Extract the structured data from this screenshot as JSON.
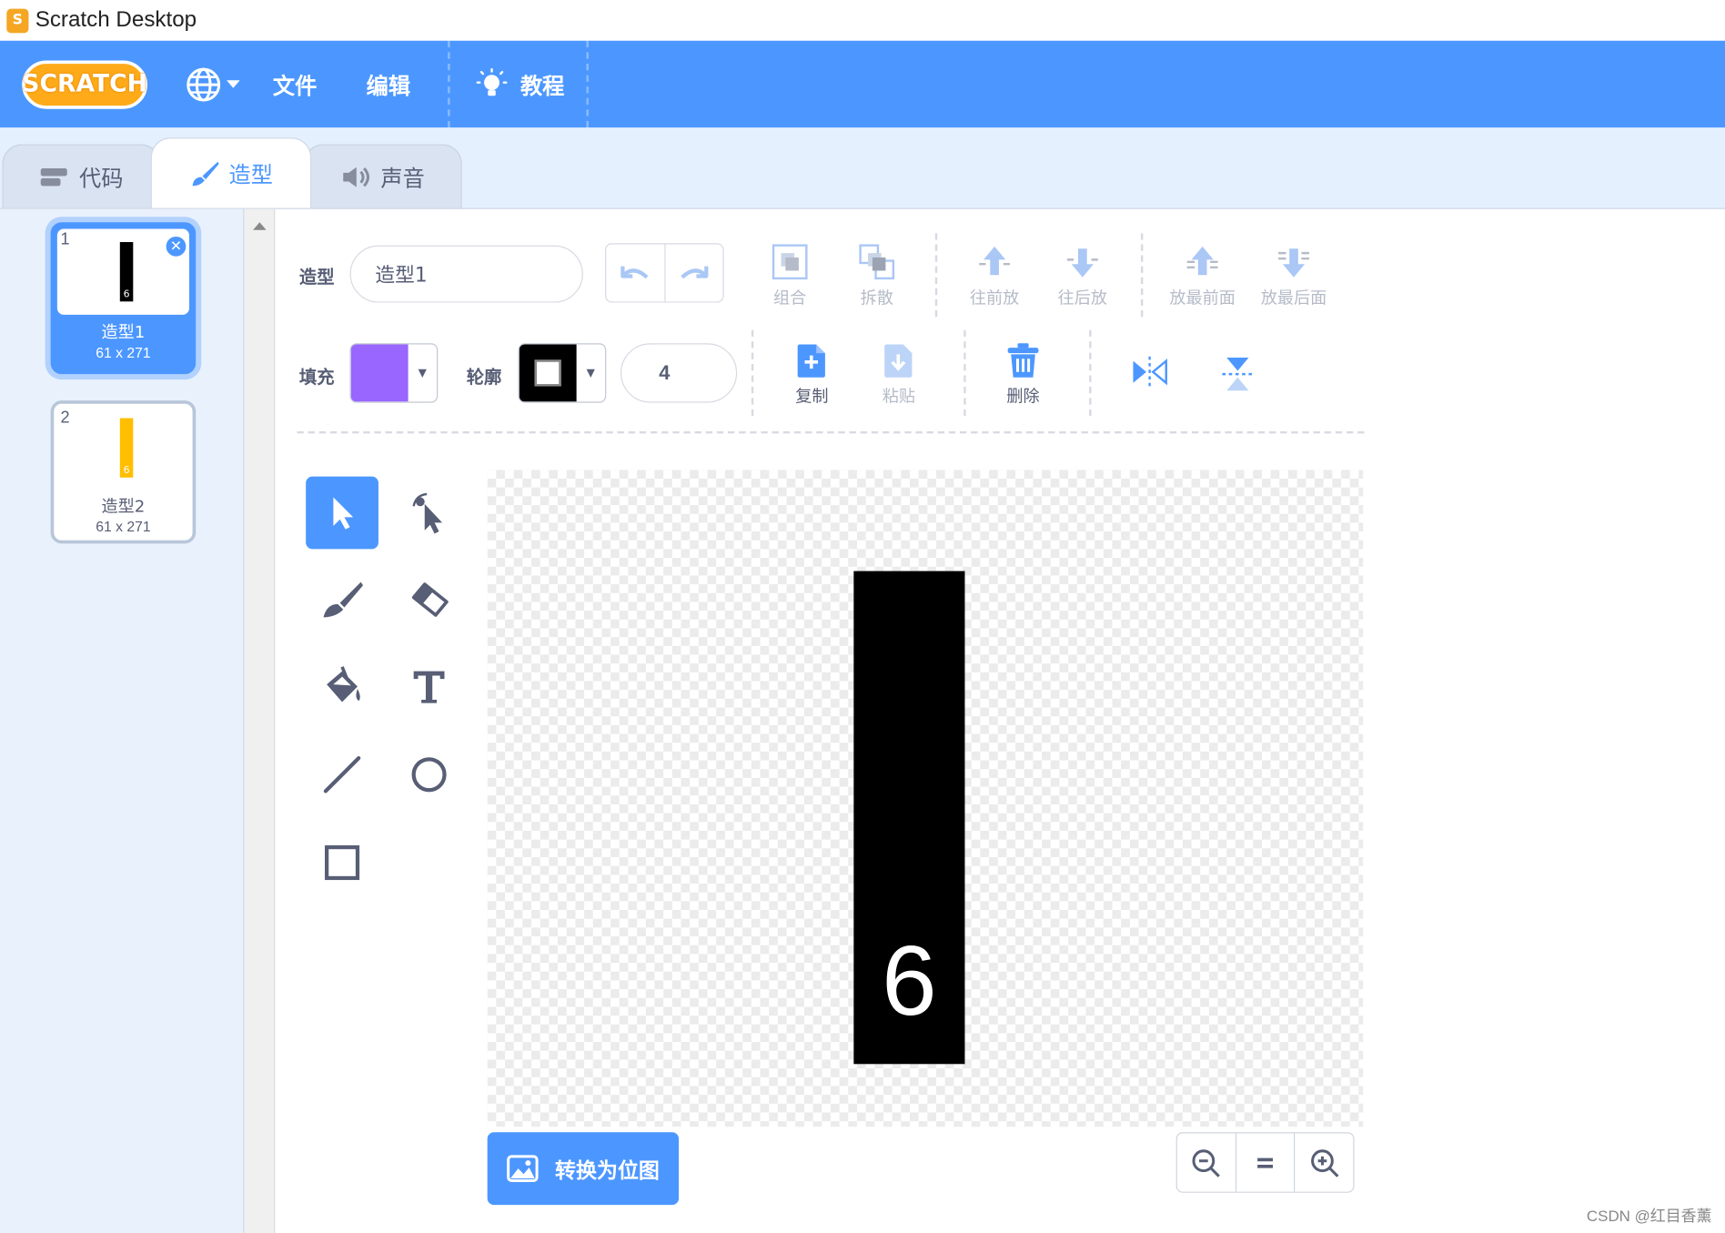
{
  "window": {
    "title": "Scratch Desktop"
  },
  "menubar": {
    "logo": "SCRATCH",
    "file": "文件",
    "edit": "编辑",
    "tutorials": "教程"
  },
  "tabs": [
    {
      "label": "代码",
      "active": false
    },
    {
      "label": "造型",
      "active": true
    },
    {
      "label": "声音",
      "active": false
    }
  ],
  "costumes": [
    {
      "number": "1",
      "name": "造型1",
      "size": "61 x 271",
      "selected": true,
      "thumb_color": "#000000",
      "thumb_digit": "6"
    },
    {
      "number": "2",
      "name": "造型2",
      "size": "61 x 271",
      "selected": false,
      "thumb_color": "#ffbf00",
      "thumb_digit": "6"
    }
  ],
  "editor": {
    "costume_label": "造型",
    "costume_name": "造型1",
    "group": "组合",
    "ungroup": "拆散",
    "forward": "往前放",
    "backward": "往后放",
    "front": "放最前面",
    "back": "放最后面",
    "fill_label": "填充",
    "fill_color": "#9966ff",
    "outline_label": "轮廓",
    "outline_color": "#000000",
    "outline_width": "4",
    "copy": "复制",
    "paste": "粘贴",
    "delete": "删除",
    "convert_bitmap": "转换为位图",
    "canvas_digit": "6"
  },
  "colors": {
    "accent": "#4c97ff",
    "text": "#575e75"
  },
  "watermark": "CSDN @红目香薰"
}
